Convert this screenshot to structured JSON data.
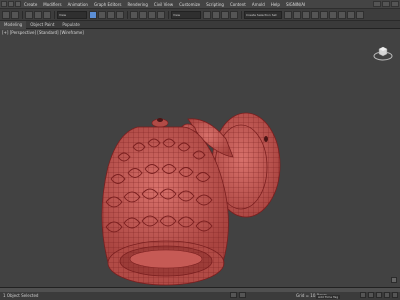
{
  "menu": {
    "items": [
      "Create",
      "Modifiers",
      "Animation",
      "Graph Editors",
      "Rendering",
      "Civil View",
      "Customize",
      "Scripting",
      "Content",
      "Arnold",
      "Help",
      "SIGNIN/AI"
    ]
  },
  "toolbar": {
    "selection_set": "Create Selection Set",
    "view_dropdown": "View"
  },
  "ribbon": {
    "tabs": [
      "Modeling",
      "Object Paint",
      "Populate"
    ]
  },
  "viewport": {
    "label": "[+] [Perspective] [Standard] [Wireframe]",
    "model_color": "#c95c57",
    "wire_color": "#7a1f1f",
    "background": "#424242"
  },
  "status": {
    "left": "1 Object Selected",
    "grid": "Grid = 10.0mm",
    "time_tag": "Add Time Tag"
  }
}
